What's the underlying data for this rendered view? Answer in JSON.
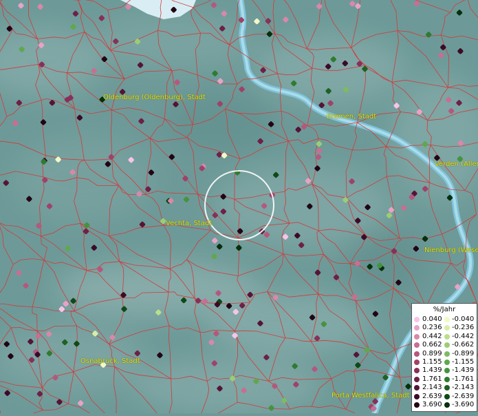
{
  "cities": [
    {
      "id": "oldenburg",
      "name": "Oldenburg (Oldenburg), Stadt"
    },
    {
      "id": "bremen",
      "name": "Bremen, Stadt"
    },
    {
      "id": "verden",
      "name": "Verden (Aller"
    },
    {
      "id": "vechta",
      "name": "Vechta, Stadt"
    },
    {
      "id": "nienburg",
      "name": "Nienburg (Wese"
    },
    {
      "id": "osnabrueck",
      "name": "Osnabrück, Stadt"
    },
    {
      "id": "porta",
      "name": "Porta Westfalica, Stadt"
    }
  ],
  "legend": {
    "title": "%/Jahr",
    "positive": [
      "0.040",
      "0.236",
      "0.442",
      "0.662",
      "0.899",
      "1.155",
      "1.439",
      "1.761",
      "2.143",
      "2.639",
      "3.690"
    ],
    "negative": [
      "-0.040",
      "-0.236",
      "-0.442",
      "-0.662",
      "-0.899",
      "-1.155",
      "-1.439",
      "-1.761",
      "-2.143",
      "-2.639",
      "-3.690"
    ],
    "positive_colors": [
      "#f7c4e8",
      "#e7a3c7",
      "#d888aa",
      "#c76f93",
      "#b4587e",
      "#9f426a",
      "#873058",
      "#6e2047",
      "#551437",
      "#3c0a26",
      "#220415"
    ],
    "negative_colors": [
      "#f3f8c6",
      "#d7eda8",
      "#b9df8c",
      "#9bcd75",
      "#7dbb62",
      "#5fa84e",
      "#46933e",
      "#2f7b30",
      "#1d6223",
      "#0f4916",
      "#05300b"
    ]
  },
  "colors": {
    "water": "#9fd4e4",
    "border": "#d23a3a",
    "land": "#6d9a98",
    "city_label": "#e6e600"
  }
}
